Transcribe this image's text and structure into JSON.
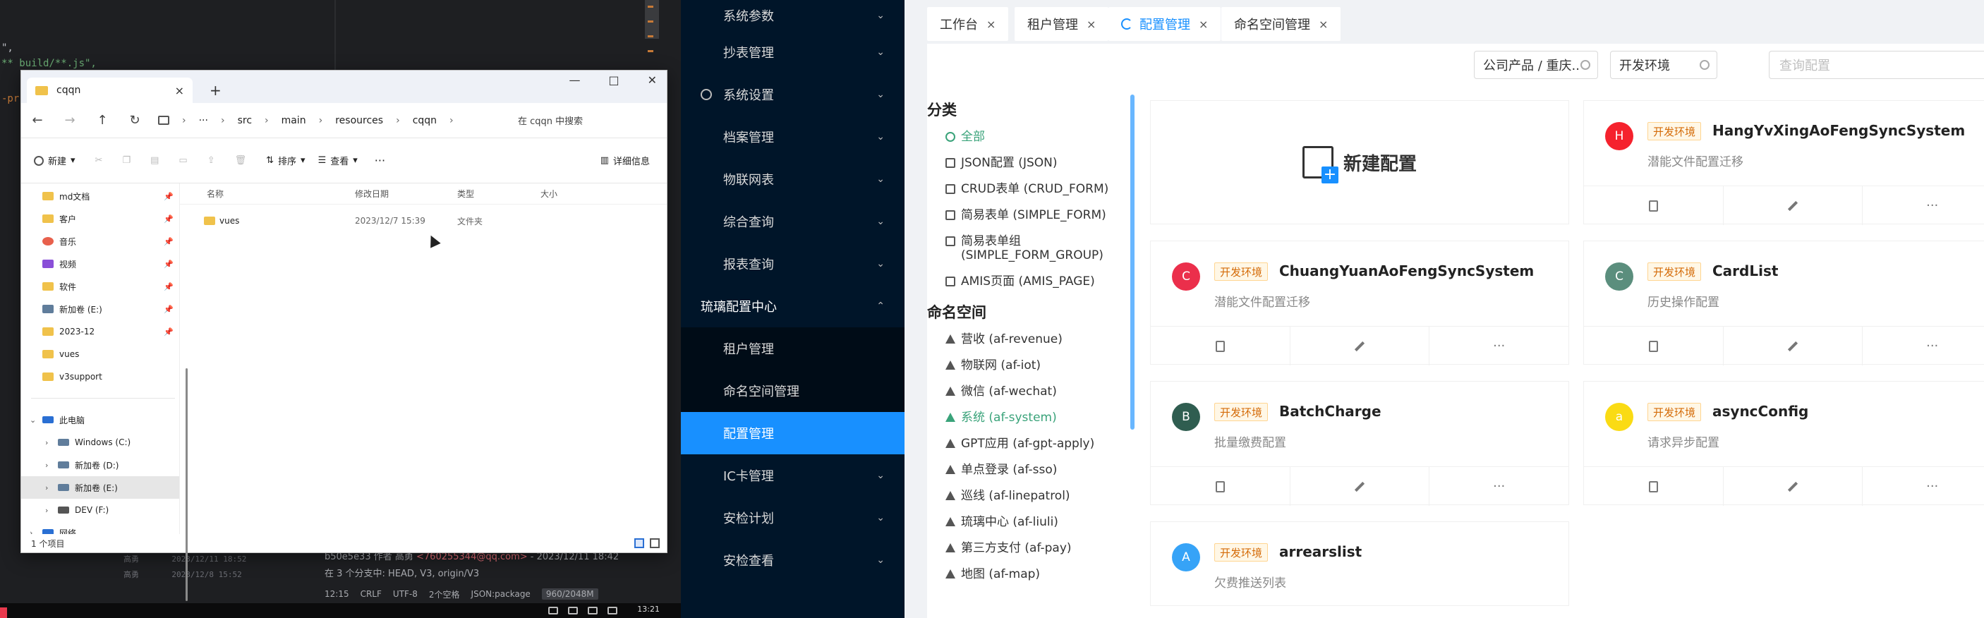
{
  "editor": {
    "lines": [
      "\",",
      "** build/**.js\",",
      "-pr"
    ],
    "vcs_line1_prefix": "b50e5e33 作者 高勇 ",
    "vcs_email": "<760255344@qq.com>",
    "vcs_line1_suffix": " - 2023/12/11 18:42",
    "vcs_line2": "在 3 个分支中: HEAD, V3, origin/V3",
    "git_rows": [
      "高勇       2023/12/11 18:52",
      "高勇       2023/12/8 15:52"
    ],
    "status": [
      "12:15",
      "CRLF",
      "UTF-8",
      "2个空格",
      "JSON:package"
    ],
    "memory": "960/2048M",
    "clock": "13:21"
  },
  "explorer": {
    "tab_title": "cqqn",
    "path": [
      "···",
      "src",
      "main",
      "resources",
      "cqqn"
    ],
    "search_placeholder": "在 cqqn 中搜索",
    "toolbar": {
      "new": "新建",
      "sort": "排序",
      "view": "查看",
      "more": "···",
      "details": "详细信息"
    },
    "sidebar_pinned": [
      "md文档",
      "客户",
      "音乐",
      "视频",
      "软件",
      "新加卷 (E:)",
      "2023-12",
      "vues",
      "v3support"
    ],
    "this_pc": "此电脑",
    "drives": [
      "Windows (C:)",
      "新加卷 (D:)",
      "新加卷 (E:)",
      "DEV (F:)"
    ],
    "network": "网络",
    "columns": [
      "名称",
      "修改日期",
      "类型",
      "大小"
    ],
    "rows": [
      {
        "name": "vues",
        "date": "2023/12/7 15:39",
        "type": "文件夹",
        "size": ""
      }
    ],
    "footer": "1 个项目"
  },
  "sidebar": {
    "items": [
      {
        "label": "系统参数",
        "type": "top"
      },
      {
        "label": "抄表管理",
        "type": "top"
      },
      {
        "label": "系统设置",
        "type": "top-icon"
      },
      {
        "label": "档案管理",
        "type": "top"
      },
      {
        "label": "物联网表",
        "type": "top"
      },
      {
        "label": "综合查询",
        "type": "top"
      },
      {
        "label": "报表查询",
        "type": "top"
      },
      {
        "label": "琉璃配置中心",
        "type": "group"
      },
      {
        "label": "租户管理",
        "type": "sub"
      },
      {
        "label": "命名空间管理",
        "type": "sub"
      },
      {
        "label": "配置管理",
        "type": "active"
      },
      {
        "label": "IC卡管理",
        "type": "top"
      },
      {
        "label": "安检计划",
        "type": "top"
      },
      {
        "label": "安检查看",
        "type": "top"
      }
    ]
  },
  "tabs": [
    {
      "label": "工作台",
      "active": false
    },
    {
      "label": "租户管理",
      "active": false
    },
    {
      "label": "配置管理",
      "active": true
    },
    {
      "label": "命名空间管理",
      "active": false
    }
  ],
  "filters": {
    "company": "公司产品 / 重庆..",
    "env": "开发环境",
    "search_placeholder": "查询配置"
  },
  "categories": {
    "title": "分类",
    "items": [
      {
        "label": "全部",
        "selected": true
      },
      {
        "label": "JSON配置 (JSON)"
      },
      {
        "label": "CRUD表单 (CRUD_FORM)"
      },
      {
        "label": "简易表单 (SIMPLE_FORM)"
      },
      {
        "label": "简易表单组 (SIMPLE_FORM_GROUP)"
      },
      {
        "label": "AMIS页面 (AMIS_PAGE)"
      }
    ]
  },
  "namespaces": {
    "title": "命名空间",
    "items": [
      {
        "label": "营收 (af-revenue)"
      },
      {
        "label": "物联网 (af-iot)"
      },
      {
        "label": "微信 (af-wechat)"
      },
      {
        "label": "系统 (af-system)",
        "selected": true
      },
      {
        "label": "GPT应用 (af-gpt-apply)"
      },
      {
        "label": "单点登录 (af-sso)"
      },
      {
        "label": "巡线 (af-linepatrol)"
      },
      {
        "label": "琉璃中心 (af-liuli)"
      },
      {
        "label": "第三方支付 (af-pay)"
      },
      {
        "label": "地图 (af-map)"
      }
    ]
  },
  "new_config_label": "新建配置",
  "cards": [
    {
      "initial": "H",
      "color": "#f5222d",
      "env": "开发环境",
      "name": "HangYvXingAoFengSyncSystem",
      "desc": "潜能文件配置迁移"
    },
    {
      "initial": "C",
      "color": "#eb2f4b",
      "env": "开发环境",
      "name": "ChuangYuanAoFengSyncSystem",
      "desc": "潜能文件配置迁移"
    },
    {
      "initial": "C",
      "color": "#5b8e7d",
      "env": "开发环境",
      "name": "CardList",
      "desc": "历史操作配置"
    },
    {
      "initial": "B",
      "color": "#2f5d50",
      "env": "开发环境",
      "name": "BatchCharge",
      "desc": "批量缴费配置"
    },
    {
      "initial": "a",
      "color": "#fadb14",
      "env": "开发环境",
      "name": "asyncConfig",
      "desc": "请求异步配置"
    },
    {
      "initial": "A",
      "color": "#36a3f7",
      "env": "开发环境",
      "name": "arrearslist",
      "desc": "欠费推送列表"
    }
  ]
}
